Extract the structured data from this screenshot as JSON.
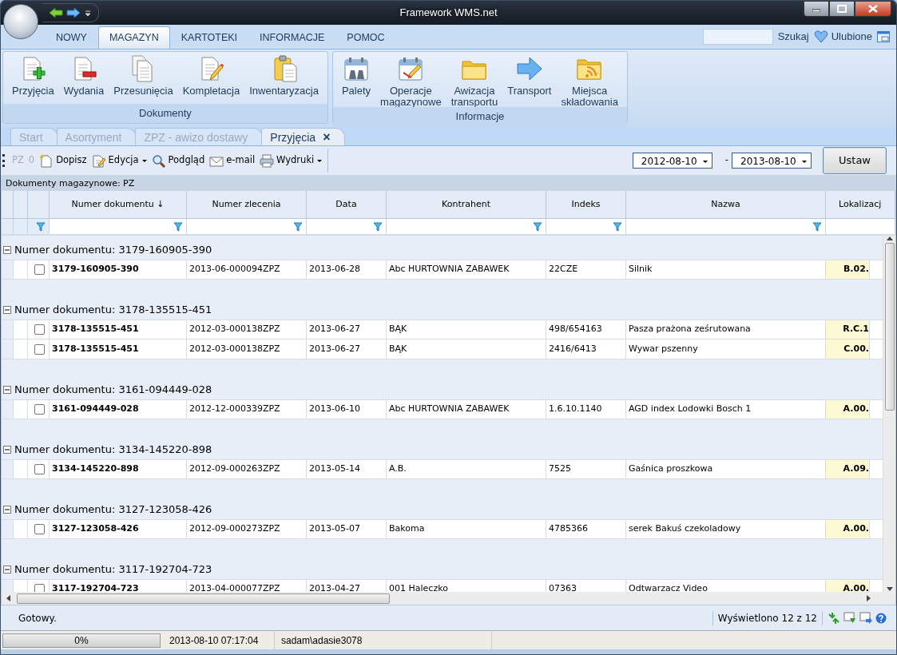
{
  "window": {
    "title": "Framework WMS.net"
  },
  "ribbon": {
    "tabs": [
      {
        "label": "NOWY",
        "selected": false
      },
      {
        "label": "MAGAZYN",
        "selected": true
      },
      {
        "label": "KARTOTEKI",
        "selected": false
      },
      {
        "label": "INFORMACJE",
        "selected": false
      },
      {
        "label": "POMOC",
        "selected": false
      }
    ],
    "search_button": "Szukaj",
    "favorites": "Ulubione",
    "groups": [
      {
        "label": "Dokumenty",
        "buttons": [
          "Przyjęcia",
          "Wydania",
          "Przesunięcia",
          "Kompletacja",
          "Inwentaryzacja"
        ]
      },
      {
        "label": "Informacje",
        "buttons": [
          "Palety",
          "Operacje\nmagazynowe",
          "Awizacja\ntransportu",
          "Transport",
          "Miejsca\nskładowania"
        ]
      }
    ]
  },
  "doc_tabs": [
    {
      "label": "Start",
      "selected": false
    },
    {
      "label": "Asortyment",
      "selected": false
    },
    {
      "label": "ZPZ - awizo dostawy",
      "selected": false
    },
    {
      "label": "Przyjęcia",
      "selected": true,
      "close": "×"
    }
  ],
  "toolbar": {
    "counter_label": "PZ",
    "counter": "0",
    "buttons": [
      {
        "label": "Dopisz",
        "dropdown": false
      },
      {
        "label": "Edycja",
        "dropdown": true
      },
      {
        "label": "Podgląd",
        "dropdown": false
      },
      {
        "label": "e-mail",
        "dropdown": false
      },
      {
        "label": "Wydruki",
        "dropdown": true
      }
    ],
    "date_from": "2012-08-10",
    "range_separator": "-",
    "date_to": "2013-08-10",
    "apply": "Ustaw"
  },
  "caption": "Dokumenty magazynowe: PZ",
  "grid": {
    "columns": [
      {
        "filter": true
      },
      {
        "label": "Numer dokumentu",
        "sort_mark": "↓",
        "filter": true
      },
      {
        "label": "Numer zlecenia",
        "filter": true
      },
      {
        "label": "Data",
        "filter": true
      },
      {
        "label": "Kontrahent",
        "filter": true
      },
      {
        "label": "Indeks",
        "filter": true
      },
      {
        "label": "Nazwa",
        "filter": true
      },
      {
        "label": "Lokalizacj",
        "filter": false
      }
    ],
    "groups": [
      {
        "title": "Numer dokumentu: 3179-160905-390",
        "expanded": true,
        "rows": [
          {
            "checked": false,
            "cells": [
              "3179-160905-390",
              "2013-06-000094ZPZ",
              "2013-06-28",
              "Abc HURTOWNIA ZABAWEK",
              "22CZE",
              "Silnik",
              "B.02."
            ]
          }
        ]
      },
      {
        "title": "Numer dokumentu: 3178-135515-451",
        "expanded": true,
        "rows": [
          {
            "checked": false,
            "cells": [
              "3178-135515-451",
              "2012-03-000138ZPZ",
              "2013-06-27",
              "BĄK",
              "498/654163",
              "Pasza prażona ześrutowana",
              "R.C.1"
            ]
          },
          {
            "checked": false,
            "cells": [
              "3178-135515-451",
              "2012-03-000138ZPZ",
              "2013-06-27",
              "BĄK",
              "2416/6413",
              "Wywar pszenny",
              "C.00."
            ]
          }
        ]
      },
      {
        "title": "Numer dokumentu: 3161-094449-028",
        "expanded": true,
        "rows": [
          {
            "checked": false,
            "cells": [
              "3161-094449-028",
              "2012-12-000339ZPZ",
              "2013-06-10",
              "Abc HURTOWNIA ZABAWEK",
              "1.6.10.1140",
              "AGD index Lodowki Bosch 1",
              "A.00."
            ]
          }
        ]
      },
      {
        "title": "Numer dokumentu: 3134-145220-898",
        "expanded": true,
        "rows": [
          {
            "checked": false,
            "cells": [
              "3134-145220-898",
              "2012-09-000263ZPZ",
              "2013-05-14",
              "A.B.",
              "7525",
              "Gaśnica proszkowa",
              "A.09."
            ]
          }
        ]
      },
      {
        "title": "Numer dokumentu: 3127-123058-426",
        "expanded": true,
        "rows": [
          {
            "checked": false,
            "cells": [
              "3127-123058-426",
              "2012-09-000273ZPZ",
              "2013-05-07",
              "Bakoma",
              "4785366",
              "serek Bakuś czekoladowy",
              "A.00."
            ]
          }
        ]
      },
      {
        "title": "Numer dokumentu: 3117-192704-723",
        "expanded": true,
        "rows": [
          {
            "checked": false,
            "cells": [
              "3117-192704-723",
              "2013-04-000077ZPZ",
              "2013-04-27",
              "001 Haleczko",
              "07363",
              "Odtwarzacz Video",
              "A.00."
            ]
          }
        ]
      }
    ]
  },
  "status": {
    "message": "Gotowy.",
    "count": "Wyświetlono 12 z 12"
  },
  "bottom_bar": {
    "progress": {
      "level": 0,
      "text": "0%"
    },
    "timestamp": "2013-08-10 07:17:04",
    "user": "sadam\\adasie3078"
  }
}
